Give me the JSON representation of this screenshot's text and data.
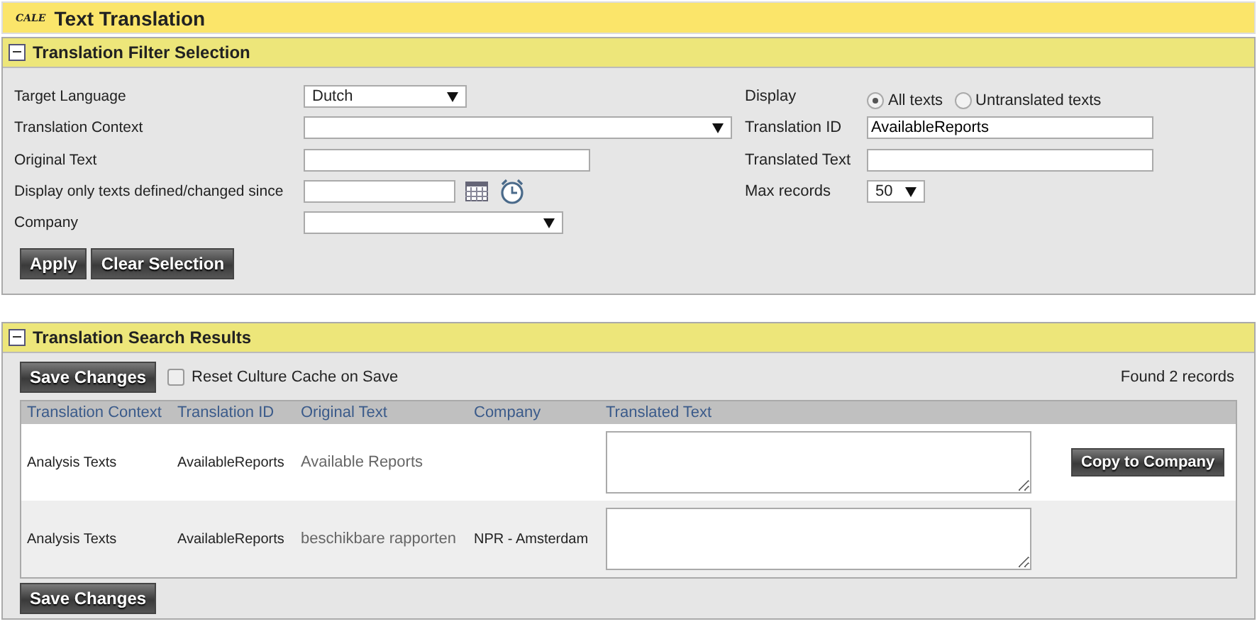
{
  "header": {
    "logo": "CALE",
    "title": "Text Translation"
  },
  "filter_panel": {
    "title": "Translation Filter Selection",
    "expanded": true,
    "left": [
      {
        "kind": "select",
        "label": "Target Language",
        "value": "Dutch"
      },
      {
        "kind": "select",
        "label": "Translation Context"
      },
      {
        "kind": "input",
        "label": "Original Text"
      },
      {
        "kind": "date",
        "label": "Display only texts defined/changed since"
      },
      {
        "kind": "select",
        "label": "Company"
      }
    ],
    "right": [
      {
        "kind": "radio",
        "label": "Display",
        "options": [
          {
            "label": "All texts",
            "selected": true
          },
          {
            "label": "Untranslated texts",
            "selected": false
          }
        ]
      },
      {
        "kind": "input",
        "label": "Translation ID",
        "value": "AvailableReports"
      },
      {
        "kind": "input",
        "label": "Translated Text"
      },
      {
        "kind": "select",
        "label": "Max records",
        "value": "50"
      }
    ],
    "buttons": [
      "Apply",
      "Clear Selection"
    ]
  },
  "results_panel": {
    "title": "Translation Search Results",
    "expanded": true,
    "save_button": "Save Changes",
    "reset_cache": {
      "label": "Reset Culture Cache on Save",
      "checked": false
    },
    "count": "Found 2 records",
    "columns": [
      "Translation Context",
      "Translation ID",
      "Original Text",
      "Company",
      "Translated Text"
    ],
    "rows": [
      {
        "context": "Analysis Texts",
        "id": "AvailableReports",
        "original": "Available Reports",
        "action": "Copy to Company"
      },
      {
        "context": "Analysis Texts",
        "id": "AvailableReports",
        "original": "beschikbare rapporten",
        "company": "NPR - Amsterdam"
      }
    ],
    "bottom_button": "Save Changes"
  }
}
